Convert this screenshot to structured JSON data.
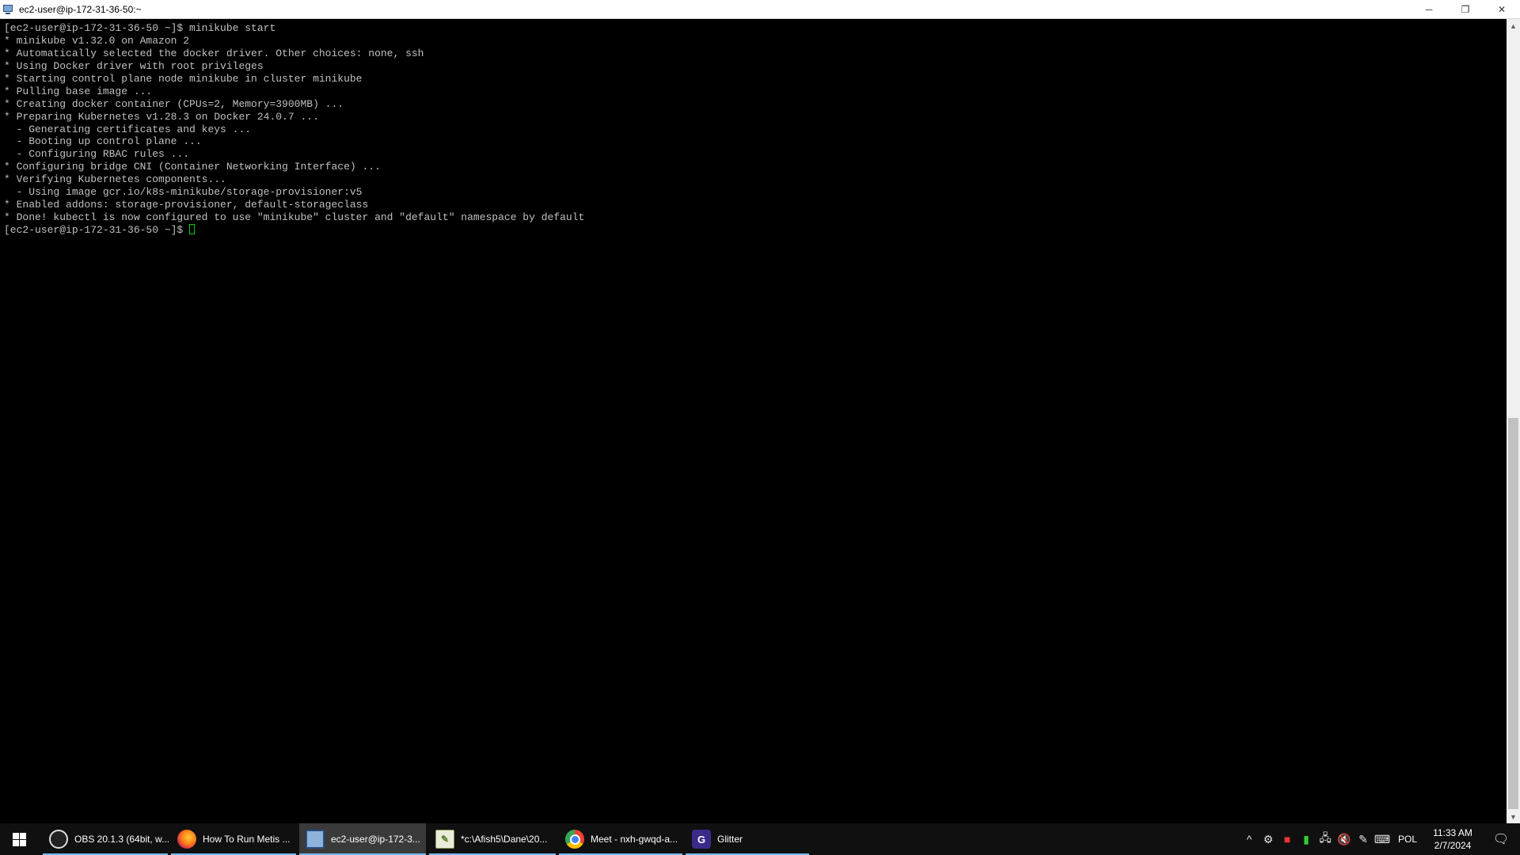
{
  "window": {
    "title": "ec2-user@ip-172-31-36-50:~",
    "minimize_glyph": "─",
    "restore_glyph": "❐",
    "close_glyph": "✕"
  },
  "terminal": {
    "lines": [
      "[ec2-user@ip-172-31-36-50 ~]$ minikube start",
      "* minikube v1.32.0 on Amazon 2",
      "* Automatically selected the docker driver. Other choices: none, ssh",
      "* Using Docker driver with root privileges",
      "* Starting control plane node minikube in cluster minikube",
      "* Pulling base image ...",
      "* Creating docker container (CPUs=2, Memory=3900MB) ...",
      "* Preparing Kubernetes v1.28.3 on Docker 24.0.7 ...",
      "  - Generating certificates and keys ...",
      "  - Booting up control plane ...",
      "  - Configuring RBAC rules ...",
      "* Configuring bridge CNI (Container Networking Interface) ...",
      "* Verifying Kubernetes components...",
      "  - Using image gcr.io/k8s-minikube/storage-provisioner:v5",
      "* Enabled addons: storage-provisioner, default-storageclass",
      "* Done! kubectl is now configured to use \"minikube\" cluster and \"default\" namespace by default"
    ],
    "prompt": "[ec2-user@ip-172-31-36-50 ~]$ "
  },
  "taskbar": {
    "items": [
      {
        "label": "OBS 20.1.3 (64bit, w...",
        "icon": "obs-icon",
        "glyph": ""
      },
      {
        "label": "How To Run Metis ...",
        "icon": "firefox-icon",
        "glyph": ""
      },
      {
        "label": "ec2-user@ip-172-3...",
        "icon": "putty-icon",
        "glyph": ""
      },
      {
        "label": "*c:\\Afish5\\Dane\\20...",
        "icon": "notepad-plus-icon",
        "glyph": "✎"
      },
      {
        "label": "Meet - nxh-gwqd-a...",
        "icon": "chrome-icon",
        "glyph": ""
      },
      {
        "label": "Glitter",
        "icon": "glitter-icon",
        "glyph": "G"
      }
    ],
    "tray": {
      "chevron_glyph": "^",
      "language": "POL",
      "time": "11:33 AM",
      "date": "2/7/2024"
    }
  },
  "colors": {
    "terminal_bg": "#000000",
    "terminal_fg": "#c0c0c0",
    "cursor": "#00d000",
    "taskbar_bg": "#101010",
    "active_underline": "#76b9ed"
  }
}
